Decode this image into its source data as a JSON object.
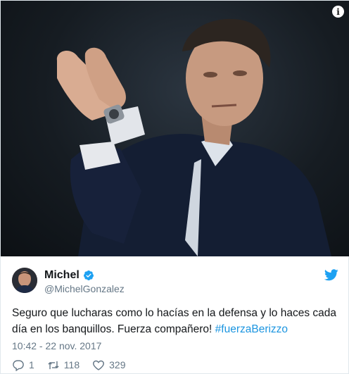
{
  "media": {
    "info_label": "i"
  },
  "author": {
    "display_name": "Michel",
    "handle": "@MichelGonzalez",
    "verified": true
  },
  "tweet": {
    "text": "Seguro que lucharas como lo hacías en la defensa y lo haces cada día en los banquillos. Fuerza compañero! ",
    "hashtag": "#fuerzaBerizzo",
    "timestamp": "10:42 - 22 nov. 2017"
  },
  "actions": {
    "replies": "1",
    "retweets": "118",
    "likes": "329"
  },
  "colors": {
    "link": "#1b95e0",
    "muted": "#657786",
    "text": "#14171a",
    "twitter_blue": "#1da1f2"
  },
  "icons": [
    "info-icon",
    "verified-icon",
    "twitter-bird-icon",
    "reply-icon",
    "retweet-icon",
    "like-icon"
  ]
}
